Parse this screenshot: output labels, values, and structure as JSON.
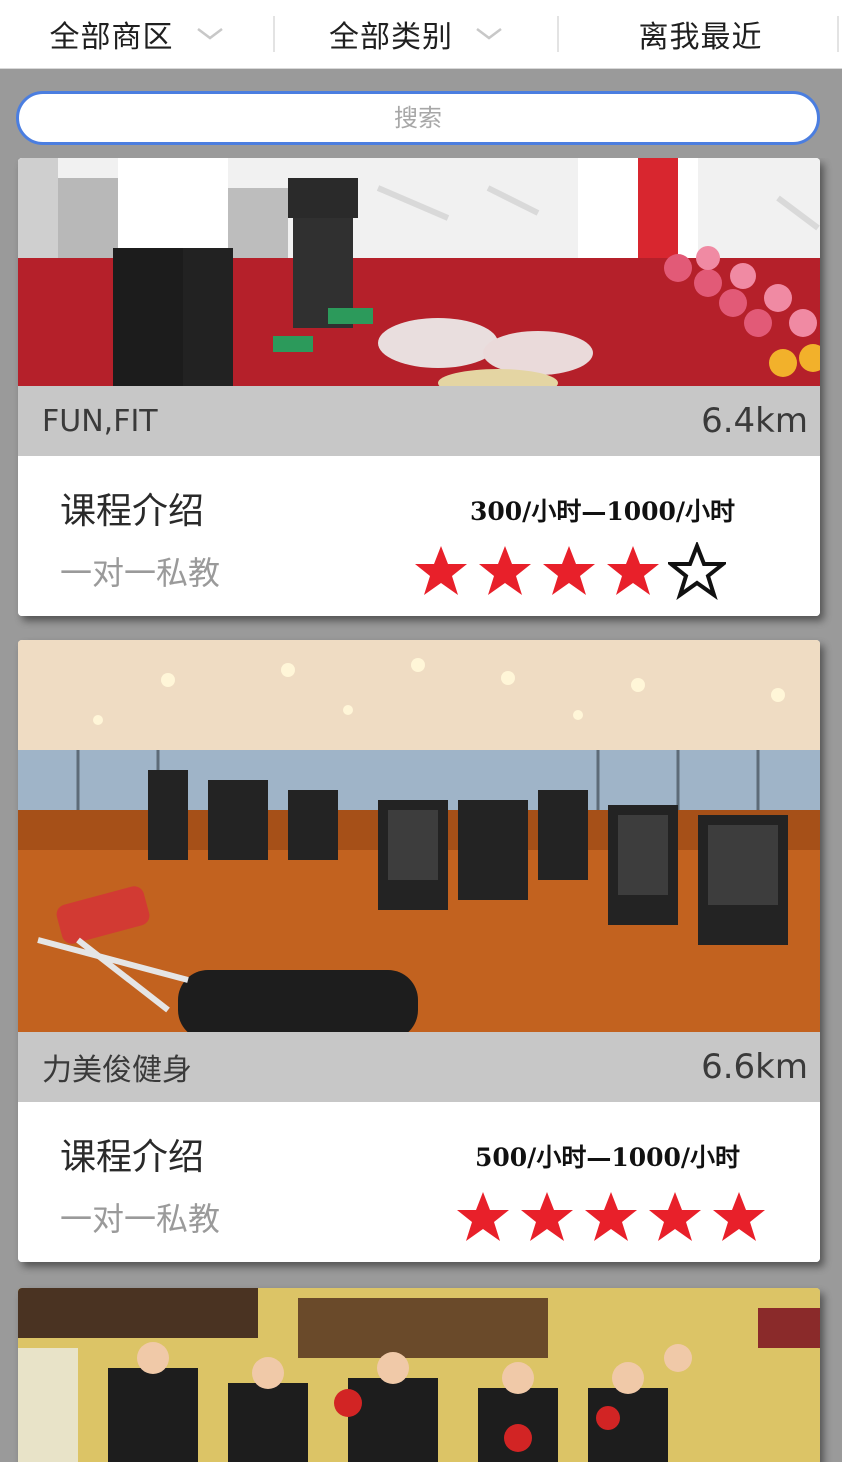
{
  "filters": {
    "district": "全部商区",
    "category": "全部类别",
    "sort": "离我最近"
  },
  "search": {
    "placeholder": "搜索"
  },
  "cards": [
    {
      "name": "FUN,FIT",
      "distance": "6.4km",
      "course_title": "课程介绍",
      "course_type": "一对一私教",
      "price": "300/小时—1000/小时",
      "rating": 4,
      "rating_max": 5
    },
    {
      "name": "力美俊健身",
      "distance": "6.6km",
      "course_title": "课程介绍",
      "course_type": "一对一私教",
      "price": "500/小时—1000/小时",
      "rating": 5,
      "rating_max": 5
    }
  ],
  "colors": {
    "star_filled": "#e8202a",
    "star_empty_stroke": "#111111",
    "search_border": "#4b7ee0"
  }
}
